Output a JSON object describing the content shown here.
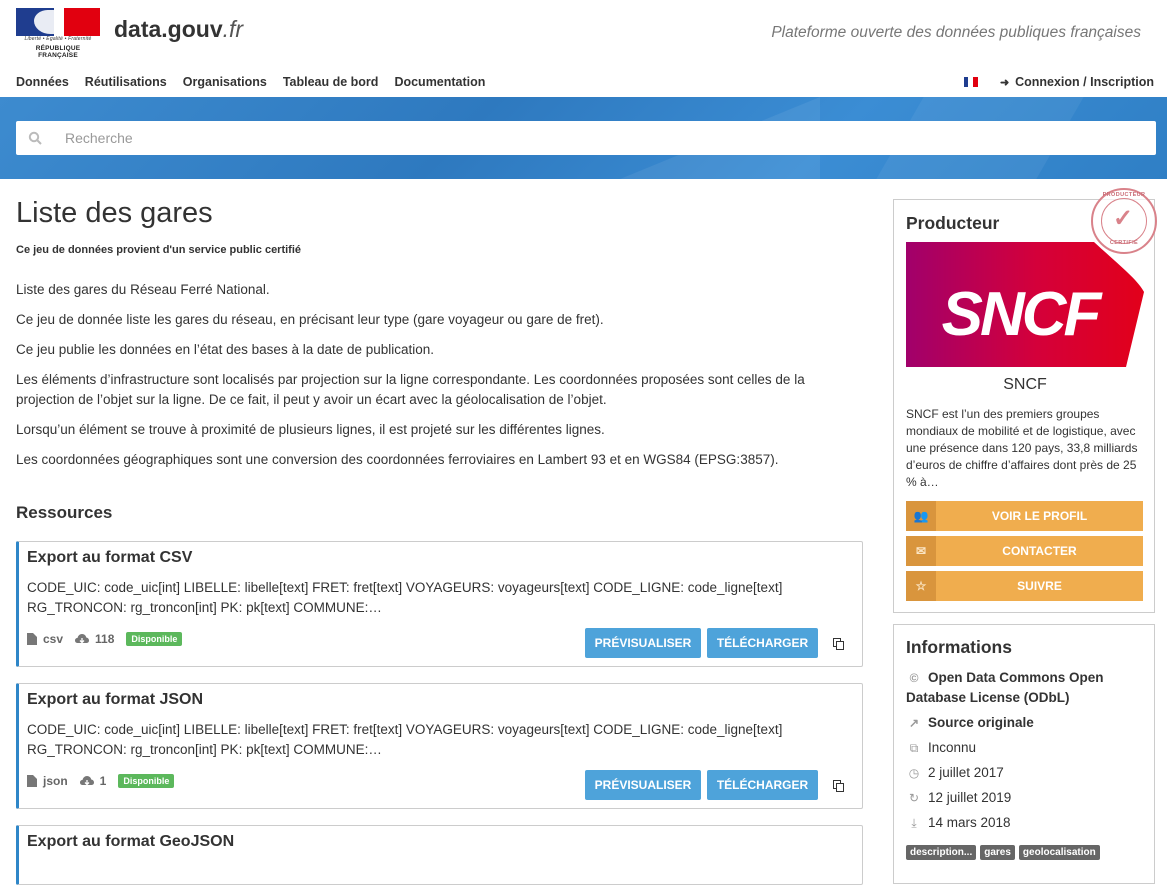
{
  "header": {
    "logo_devise": "Liberté • Égalité • Fraternité",
    "logo_rf": "République Française",
    "brand_name": "data.gouv",
    "brand_tld": ".fr",
    "tagline": "Plateforme ouverte des données publiques françaises",
    "nav": [
      "Données",
      "Réutilisations",
      "Organisations",
      "Tableau de bord",
      "Documentation"
    ],
    "login": "Connexion / Inscription"
  },
  "search": {
    "placeholder": "Recherche"
  },
  "dataset": {
    "title": "Liste des gares",
    "certified": "Ce jeu de données provient d'un service public certifié",
    "description": [
      "Liste des gares du Réseau Ferré National.",
      "Ce jeu de donnée liste les gares du réseau, en précisant leur type (gare voyageur ou gare de fret).",
      "Ce jeu publie les données en l’état des bases à la date de publication.",
      "Les éléments d’infrastructure sont localisés par projection sur la ligne correspondante. Les coordonnées proposées sont celles de la projection de l’objet sur la ligne. De ce fait, il peut y avoir un écart avec la géolocalisation de l’objet.",
      "Lorsqu’un élément se trouve à proximité de plusieurs lignes, il est projeté sur les différentes lignes.",
      "Les coordonnées géographiques sont une conversion des coordonnées ferroviaires en Lambert 93 et en WGS84 (EPSG:3857)."
    ]
  },
  "resources": {
    "heading": "Ressources",
    "items": [
      {
        "title": "Export au format CSV",
        "desc": "CODE_UIC: code_uic[int] LIBELLE: libelle[text] FRET: fret[text] VOYAGEURS: voyageurs[text] CODE_LIGNE: code_ligne[text] RG_TRONCON: rg_troncon[int] PK: pk[text] COMMUNE:…",
        "format": "csv",
        "downloads": "118",
        "status": "Disponible",
        "preview": "PRÉVISUALISER",
        "download": "TÉLÉCHARGER"
      },
      {
        "title": "Export au format JSON",
        "desc": "CODE_UIC: code_uic[int] LIBELLE: libelle[text] FRET: fret[text] VOYAGEURS: voyageurs[text] CODE_LIGNE: code_ligne[text] RG_TRONCON: rg_troncon[int] PK: pk[text] COMMUNE:…",
        "format": "json",
        "downloads": "1",
        "status": "Disponible",
        "preview": "PRÉVISUALISER",
        "download": "TÉLÉCHARGER"
      },
      {
        "title": "Export au format GeoJSON"
      }
    ]
  },
  "producer": {
    "heading": "Producteur",
    "stamp_top": "PRODUCTEUR",
    "stamp_bottom": "CERTIFIÉ",
    "logo_text": "SNCF",
    "name": "SNCF",
    "description": "SNCF est l’un des premiers groupes mondiaux de mobilité et de logistique, avec une présence dans 120 pays, 33,8 milliards d’euros de chiffre d’affaires dont près de 25 % à…",
    "buttons": [
      "VOIR LE PROFIL",
      "CONTACTER",
      "SUIVRE"
    ]
  },
  "informations": {
    "heading": "Informations",
    "license": "Open Data Commons Open Database License (ODbL)",
    "source": "Source originale",
    "frequency": "Inconnu",
    "created": "2 juillet 2017",
    "updated": "12 juillet 2019",
    "modified": "14 mars 2018",
    "tags": [
      "description...",
      "gares",
      "geolocalisation"
    ]
  },
  "colors": {
    "accent": "#4ea3da",
    "warning": "#f0ad4e",
    "success": "#5cb85c",
    "hero": "#2e79bf",
    "sncf_red": "#e2001a",
    "sncf_purple": "#a1006b"
  }
}
